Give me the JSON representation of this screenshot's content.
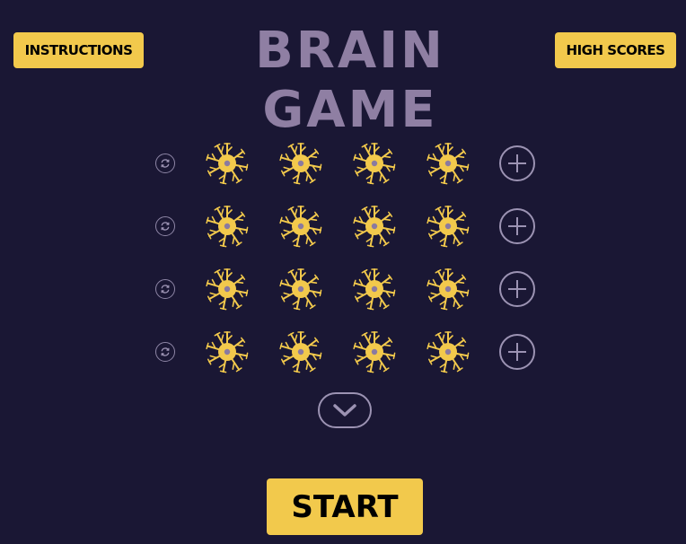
{
  "header": {
    "instructions_label": "INSTRUCTIONS",
    "title": "BRAIN GAME",
    "high_scores_label": "HIGH SCORES"
  },
  "grid": {
    "rows": 4,
    "neurons_per_row": 4,
    "row_refresh_icon": "refresh-icon",
    "row_add_icon": "plus-icon",
    "cell_icon": "neuron-icon"
  },
  "expand_icon": "chevron-down-icon",
  "start_label": "START",
  "colors": {
    "background": "#1a1734",
    "accent_yellow": "#f2c94c",
    "title": "#8f7fa3",
    "outline": "#9c93b3",
    "neuron_core": "#8a7aa0"
  }
}
